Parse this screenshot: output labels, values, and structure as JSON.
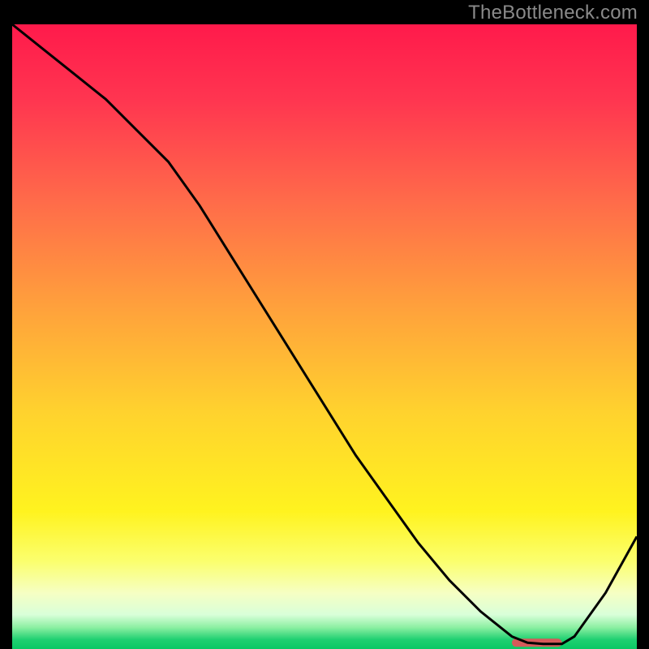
{
  "watermark": "TheBottleneck.com",
  "chart_data": {
    "type": "line",
    "title": "",
    "xlabel": "",
    "ylabel": "",
    "xlim": [
      0,
      100
    ],
    "ylim": [
      0,
      100
    ],
    "series": [
      {
        "name": "curve",
        "x": [
          0,
          5,
          10,
          15,
          20,
          25,
          30,
          35,
          40,
          45,
          50,
          55,
          60,
          65,
          70,
          75,
          80,
          82.5,
          85,
          88,
          90,
          95,
          100
        ],
        "y": [
          100,
          96,
          92,
          88,
          83,
          78,
          71,
          63,
          55,
          47,
          39,
          31,
          24,
          17,
          11,
          6,
          2,
          1,
          0.8,
          0.8,
          2,
          9,
          18
        ]
      }
    ],
    "marker": {
      "x_start": 80,
      "x_end": 88,
      "y": 1
    },
    "gradient_stops": [
      {
        "pos": 0.0,
        "color": "#ff1a4b"
      },
      {
        "pos": 0.12,
        "color": "#ff3550"
      },
      {
        "pos": 0.28,
        "color": "#ff6a4a"
      },
      {
        "pos": 0.45,
        "color": "#ffa03c"
      },
      {
        "pos": 0.62,
        "color": "#ffd22e"
      },
      {
        "pos": 0.78,
        "color": "#fff31f"
      },
      {
        "pos": 0.86,
        "color": "#fbff6e"
      },
      {
        "pos": 0.91,
        "color": "#f6ffc3"
      },
      {
        "pos": 0.945,
        "color": "#d9ffd9"
      },
      {
        "pos": 0.965,
        "color": "#8ef0a3"
      },
      {
        "pos": 0.985,
        "color": "#1fd071"
      },
      {
        "pos": 1.0,
        "color": "#0ac864"
      }
    ],
    "marker_color": "#d65a5a",
    "curve_color": "#000000"
  }
}
